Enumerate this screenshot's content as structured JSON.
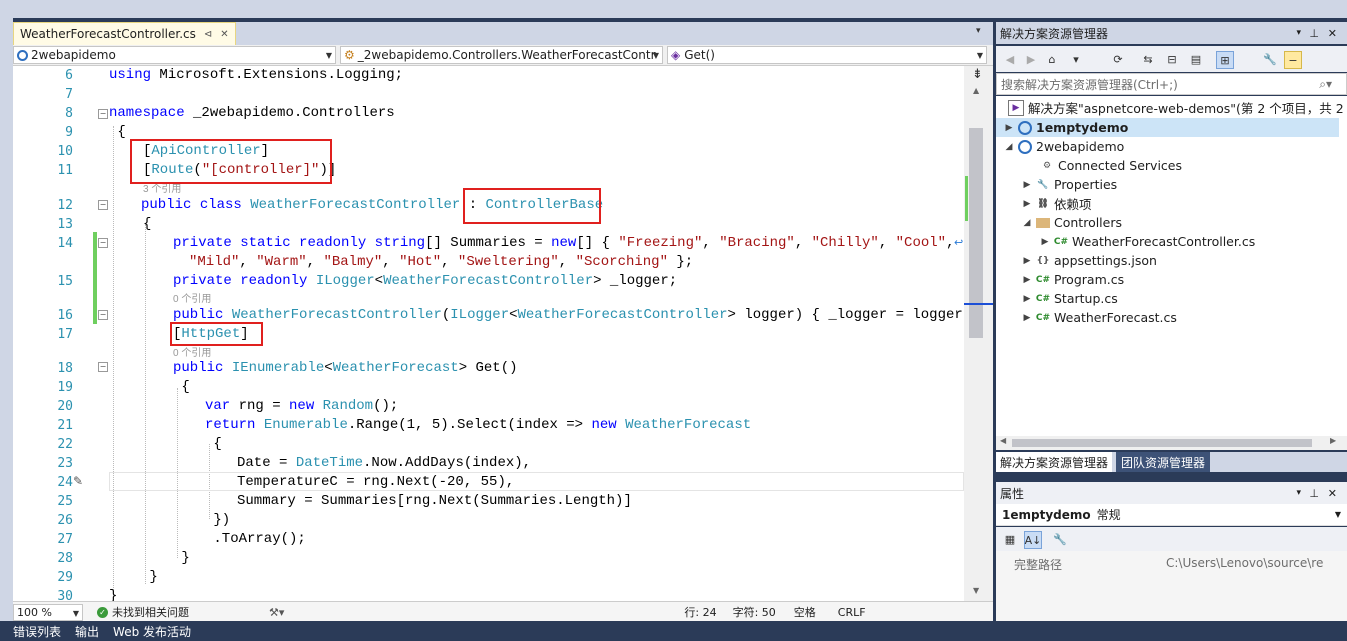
{
  "editor_tab": {
    "label": "WeatherForecastController.cs",
    "pin": "⊲",
    "close": "✕"
  },
  "nav": {
    "project": "2webapidemo",
    "class": "_2webapidemo.Controllers.WeatherForecastContr",
    "member": "Get()"
  },
  "code": {
    "lines": [
      {
        "n": "6"
      },
      {
        "n": "7"
      },
      {
        "n": "8"
      },
      {
        "n": "9"
      },
      {
        "n": "10"
      },
      {
        "n": "11"
      },
      {
        "n": "12"
      },
      {
        "n": "13"
      },
      {
        "n": "14"
      },
      {
        "n": "15"
      },
      {
        "n": "16"
      },
      {
        "n": "17"
      },
      {
        "n": "18"
      },
      {
        "n": "19"
      },
      {
        "n": "20"
      },
      {
        "n": "21"
      },
      {
        "n": "22"
      },
      {
        "n": "23"
      },
      {
        "n": "24"
      },
      {
        "n": "25"
      },
      {
        "n": "26"
      },
      {
        "n": "27"
      },
      {
        "n": "28"
      },
      {
        "n": "29"
      },
      {
        "n": "30"
      }
    ],
    "refs_3": "3 个引用",
    "refs_0a": "0 个引用",
    "refs_0b": "0 个引用"
  },
  "status": {
    "zoom": "100 %",
    "issues": "未找到相关问题",
    "line": "行: 24",
    "char": "字符: 50",
    "spaces": "空格",
    "eol": "CRLF"
  },
  "bottom_tabs": [
    "错误列表",
    "输出",
    "Web 发布活动"
  ],
  "solution_explorer": {
    "title": "解决方案资源管理器",
    "search_placeholder": "搜索解决方案资源管理器(Ctrl+;)",
    "items": [
      {
        "label": "解决方案\"aspnetcore-web-demos\"(第 2 个项目，共 2 个"
      },
      {
        "label": "1emptydemo"
      },
      {
        "label": "2webapidemo"
      },
      {
        "label": "Connected Services"
      },
      {
        "label": "Properties"
      },
      {
        "label": "依赖项"
      },
      {
        "label": "Controllers"
      },
      {
        "label": "WeatherForecastController.cs"
      },
      {
        "label": "appsettings.json"
      },
      {
        "label": "Program.cs"
      },
      {
        "label": "Startup.cs"
      },
      {
        "label": "WeatherForecast.cs"
      }
    ],
    "tabs": [
      "解决方案资源管理器",
      "团队资源管理器"
    ]
  },
  "properties": {
    "title": "属性",
    "object": "1emptydemo",
    "object_kind": "常规",
    "row_label": "完整路径",
    "row_value": "C:\\Users\\Lenovo\\source\\re"
  },
  "colors": {
    "accent_red": "#e0201e",
    "ide_blue": "#2b3b58",
    "keyword": "#0000ff",
    "type": "#2b91af",
    "string": "#a31515"
  }
}
